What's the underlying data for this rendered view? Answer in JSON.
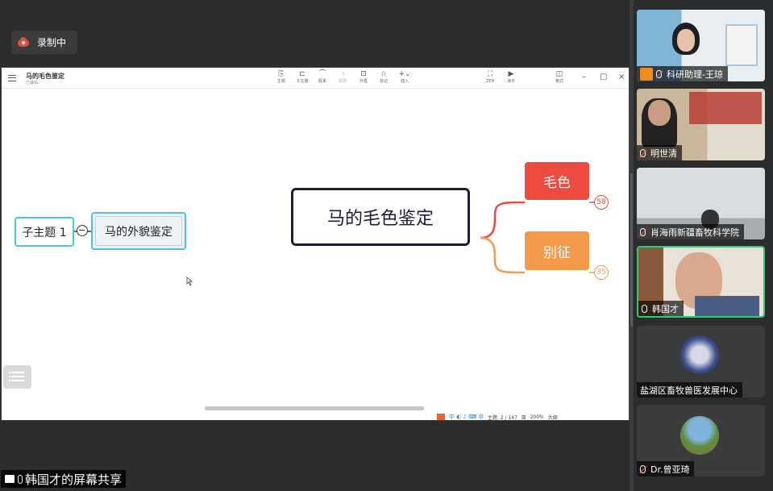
{
  "recording": {
    "label": "录制中"
  },
  "doc": {
    "title": "马的毛色鉴定",
    "subtitle": "已编辑"
  },
  "toolbar": {
    "items": [
      {
        "icon": "主题",
        "label": "主题"
      },
      {
        "icon": "子主题",
        "label": "子主题"
      },
      {
        "icon": "联系",
        "label": "联系"
      },
      {
        "icon": "概要",
        "label": "概要"
      },
      {
        "icon": "外框",
        "label": "外框"
      },
      {
        "icon": "标记",
        "label": "标记"
      },
      {
        "icon": "插入",
        "label": "插入"
      },
      {
        "icon": "ZEN",
        "label": "ZEN"
      },
      {
        "icon": "演示",
        "label": "演示"
      },
      {
        "icon": "格式",
        "label": "格式"
      }
    ],
    "minimize": "–",
    "maximize": "▢",
    "close": "×"
  },
  "mindmap": {
    "central": "马的毛色鉴定",
    "branch_color": {
      "label": "毛色",
      "count": "58",
      "color": "#ed4b3f"
    },
    "branch_mark": {
      "label": "别征",
      "count": "35",
      "color": "#f39b4b"
    },
    "floating_appearance": "马的外貌鉴定",
    "floating_subtopic": "子主题 1"
  },
  "statusbar": {
    "topic_count": "主题: 2 / 147",
    "zoom": "200%",
    "outline": "大纲"
  },
  "participants": [
    {
      "name": "科研助理-王琼",
      "host": true,
      "muted": true
    },
    {
      "name": "明世清",
      "host": false,
      "muted": true
    },
    {
      "name": "肖海雨新疆畜牧科学院",
      "host": false,
      "muted": true
    },
    {
      "name": "韩国才",
      "host": false,
      "muted": false,
      "speaking": true
    },
    {
      "name": "盐湖区畜牧兽医发展中心",
      "host": false,
      "muted": false
    },
    {
      "name": "Dr.曾亚琦",
      "host": false,
      "muted": true
    }
  ],
  "screen_share": {
    "label": "韩国才的屏幕共享"
  }
}
